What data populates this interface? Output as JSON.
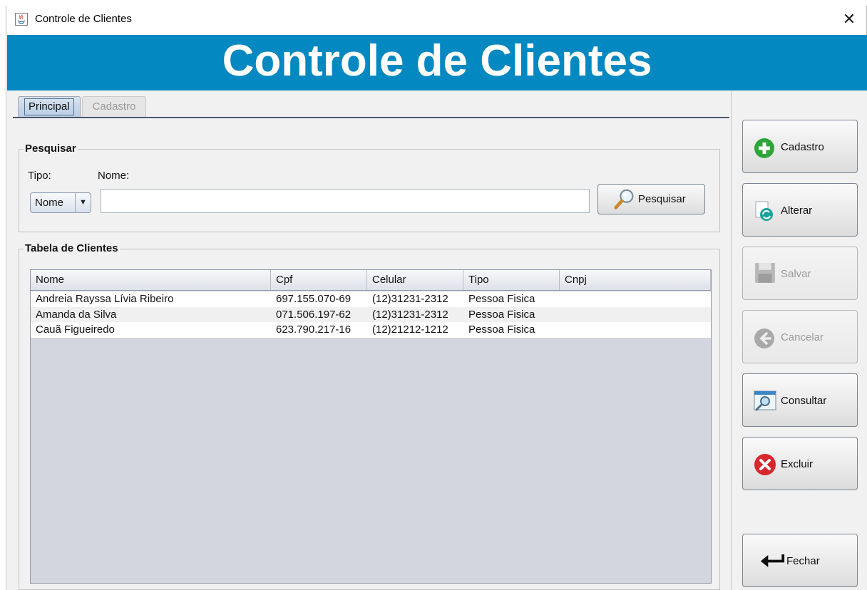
{
  "window": {
    "title": "Controle de Clientes"
  },
  "banner": {
    "text": "Controle de Clientes"
  },
  "tabs": [
    {
      "label": "Principal",
      "active": true
    },
    {
      "label": "Cadastro",
      "active": false
    }
  ],
  "search": {
    "group_title": "Pesquisar",
    "type_label": "Tipo:",
    "name_label": "Nome:",
    "type_value": "Nome",
    "name_value": "",
    "button_label": "Pesquisar"
  },
  "table": {
    "group_title": "Tabela de Clientes",
    "columns": [
      "Nome",
      "Cpf",
      "Celular",
      "Tipo",
      "Cnpj"
    ],
    "rows": [
      [
        "Andreia Rayssa Lívia Ribeiro",
        "697.155.070-69",
        "(12)31231-2312",
        "Pessoa Fisica",
        ""
      ],
      [
        "Amanda da Silva",
        "071.506.197-62",
        "(12)31231-2312",
        "Pessoa Fisica",
        ""
      ],
      [
        "Cauã Figueiredo",
        "623.790.217-16",
        "(12)21212-1212",
        "Pessoa Fisica",
        ""
      ]
    ]
  },
  "actions": {
    "cadastro": "Cadastro",
    "alterar": "Alterar",
    "salvar": "Salvar",
    "cancelar": "Cancelar",
    "consultar": "Consultar",
    "excluir": "Excluir",
    "fechar": "Fechar"
  },
  "colors": {
    "banner": "#0388c1",
    "add_icon": "#2ea53a",
    "delete_icon": "#d9262c",
    "refresh_icon": "#1aa39b"
  }
}
